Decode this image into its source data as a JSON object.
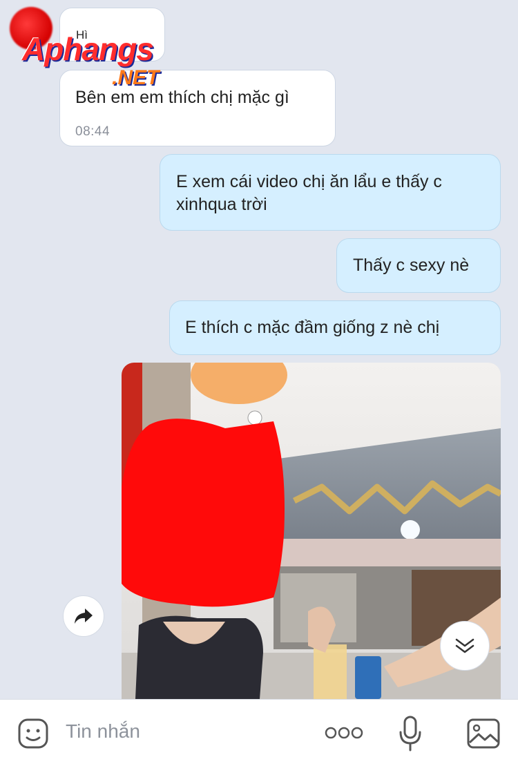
{
  "messages": [
    {
      "side": "in",
      "text": "Hì"
    },
    {
      "side": "in",
      "text": "Bên em em thích chị mặc gì",
      "time": "08:44"
    },
    {
      "side": "out",
      "text": "E xem cái video chị ăn lẩu e thấy c xinhqua trời"
    },
    {
      "side": "out",
      "text": "Thấy c sexy nè"
    },
    {
      "side": "out",
      "text": "E thích c mặc đầm giống z nè chị"
    }
  ],
  "watermark": {
    "brand": "Aphangs",
    "domain": ".NET"
  },
  "composer": {
    "placeholder": "Tin nhắn"
  },
  "icons": {
    "forward": "forward-arrow-icon",
    "scroll_down": "double-chevron-down-icon",
    "sticker": "sticker-face-icon",
    "more": "more-dots-icon",
    "voice": "microphone-icon",
    "image": "image-gallery-icon"
  },
  "colors": {
    "incoming_bubble": "#ffffff",
    "outgoing_bubble": "#d5efff",
    "background": "#e2e6ef"
  }
}
